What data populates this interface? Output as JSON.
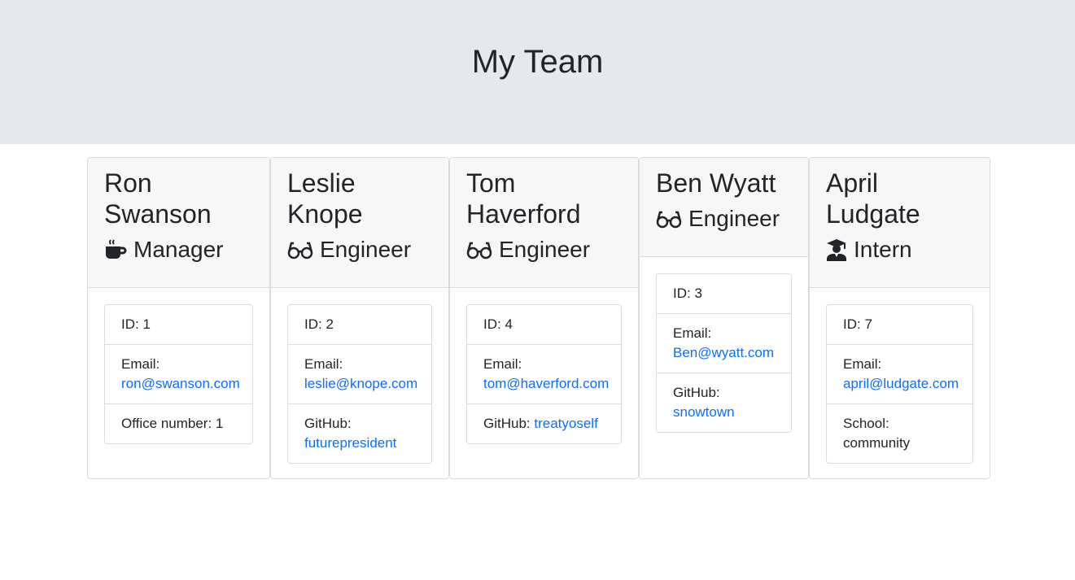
{
  "header": {
    "title": "My Team"
  },
  "members": [
    {
      "name": "Ron Swanson",
      "role": "Manager",
      "role_icon": "coffee-icon",
      "id_text": "ID: 1",
      "email_label": "Email:",
      "email": "ron@swanson.com",
      "extra_label": "Office number: 1",
      "extra_value": ""
    },
    {
      "name": "Leslie Knope",
      "role": "Engineer",
      "role_icon": "glasses-icon",
      "id_text": "ID: 2",
      "email_label": "Email:",
      "email": "leslie@knope.com",
      "extra_label": "GitHub:",
      "extra_value": "futurepresident"
    },
    {
      "name": "Tom Haverford",
      "role": "Engineer",
      "role_icon": "glasses-icon",
      "id_text": "ID: 4",
      "email_label": "Email:",
      "email": "tom@haverford.com",
      "extra_label": "GitHub:",
      "extra_value": "treatyoself"
    },
    {
      "name": "Ben Wyatt",
      "role": "Engineer",
      "role_icon": "glasses-icon",
      "id_text": "ID: 3",
      "email_label": "Email:",
      "email": "Ben@wyatt.com",
      "extra_label": "GitHub:",
      "extra_value": "snowtown"
    },
    {
      "name": "April Ludgate",
      "role": "Intern",
      "role_icon": "graduate-icon",
      "id_text": "ID: 7",
      "email_label": "Email:",
      "email": "april@ludgate.com",
      "extra_label": "School: community",
      "extra_value": ""
    }
  ]
}
